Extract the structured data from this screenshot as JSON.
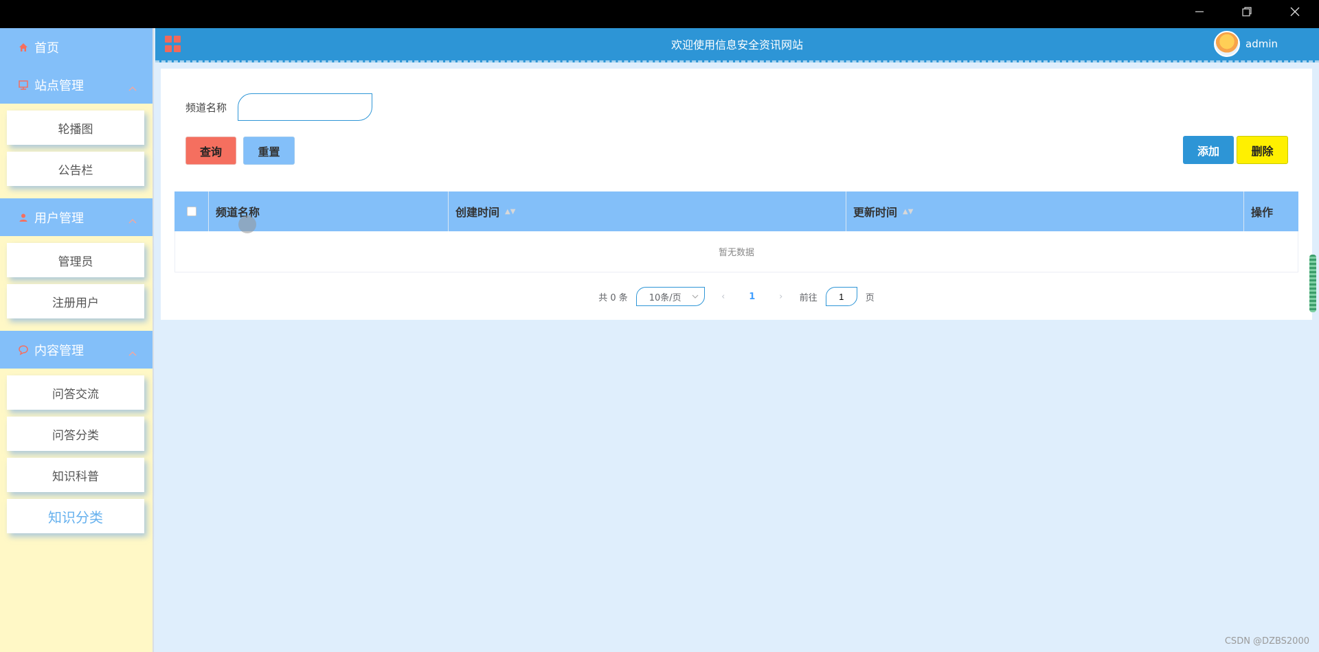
{
  "window": {
    "minimize_icon": "minimize-icon",
    "maximize_icon": "restore-icon",
    "close_icon": "close-icon"
  },
  "sidebar": {
    "home": {
      "label": "首页",
      "icon": "home-icon"
    },
    "groups": [
      {
        "label": "站点管理",
        "icon": "monitor-icon",
        "items": [
          "轮播图",
          "公告栏"
        ]
      },
      {
        "label": "用户管理",
        "icon": "user-icon",
        "items": [
          "管理员",
          "注册用户"
        ]
      },
      {
        "label": "内容管理",
        "icon": "chat-icon",
        "items": [
          "问答交流",
          "问答分类",
          "知识科普",
          "知识分类"
        ]
      }
    ],
    "active_item": "知识分类"
  },
  "header": {
    "title": "欢迎使用信息安全资讯网站",
    "username": "admin"
  },
  "search": {
    "label": "频道名称",
    "value": "",
    "placeholder": ""
  },
  "buttons": {
    "query": "查询",
    "reset": "重置",
    "add": "添加",
    "delete": "删除"
  },
  "table": {
    "columns": [
      "频道名称",
      "创建时间",
      "更新时间",
      "操作"
    ],
    "rows": [],
    "empty_text": "暂无数据"
  },
  "pagination": {
    "total": "共 0 条",
    "page_size": "10条/页",
    "current_page": "1",
    "goto_label": "前往",
    "goto_value": "1",
    "page_suffix": "页"
  },
  "watermark": "CSDN @DZBS2000",
  "colors": {
    "primary": "#2d95d6",
    "sidebar_bg": "#fff8c6",
    "sidebar_head": "#83bff9",
    "danger": "#f56f5f",
    "delete": "#fff000"
  }
}
